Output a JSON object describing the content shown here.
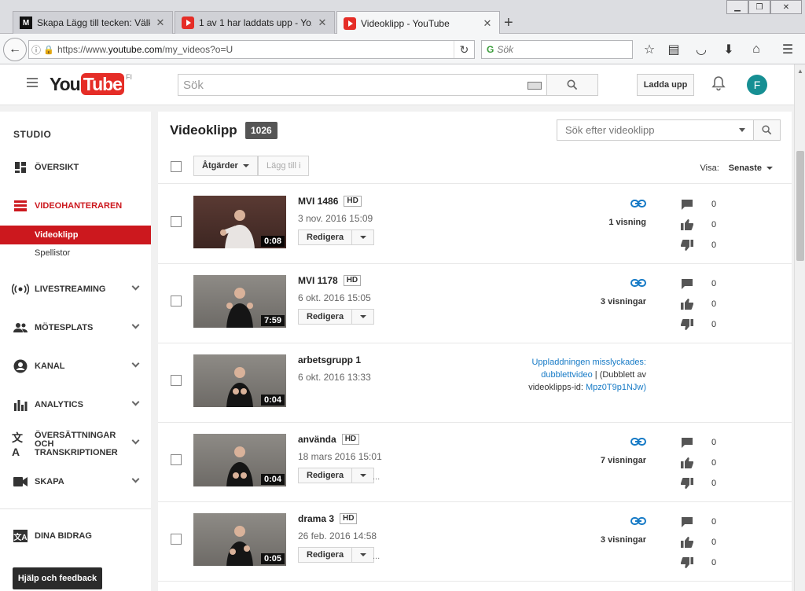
{
  "browser": {
    "tabs": [
      {
        "title": "Skapa Lägg till tecken: Välk...",
        "icon": "mq-favicon"
      },
      {
        "title": "1 av 1 har laddats upp - Yo...",
        "icon": "youtube-favicon"
      },
      {
        "title": "Videoklipp - YouTube",
        "icon": "youtube-favicon"
      }
    ],
    "url_prefix": "https://www.",
    "url_domain": "youtube.com",
    "url_path": "/my_videos?o=U",
    "search_placeholder": "Sök"
  },
  "header": {
    "logo_you": "You",
    "logo_tube": "Tube",
    "logo_country": "FI",
    "search_placeholder": "Sök",
    "upload_label": "Ladda upp",
    "avatar_letter": "F"
  },
  "sidebar": {
    "studio_label": "STUDIO",
    "items": [
      {
        "label": "ÖVERSIKT",
        "icon": "dashboard-icon"
      },
      {
        "label": "VIDEOHANTERAREN",
        "icon": "video-manager-icon"
      },
      {
        "label": "LIVESTREAMING",
        "icon": "live-icon"
      },
      {
        "label": "MÖTESPLATS",
        "icon": "community-icon"
      },
      {
        "label": "KANAL",
        "icon": "channel-icon"
      },
      {
        "label": "ANALYTICS",
        "icon": "analytics-icon"
      },
      {
        "label": "ÖVERSÄTTNINGAR OCH TRANSKRIPTIONER",
        "icon": "translate-icon"
      },
      {
        "label": "SKAPA",
        "icon": "create-icon"
      },
      {
        "label": "DINA BIDRAG",
        "icon": "contributions-icon"
      }
    ],
    "subitems": [
      "Videoklipp",
      "Spellistor"
    ],
    "help_label": "Hjälp och feedback"
  },
  "main": {
    "title": "Videoklipp",
    "count": "1026",
    "video_search_placeholder": "Sök efter videoklipp",
    "actions_label": "Åtgärder",
    "add_to_label": "Lägg till i",
    "view_label": "Visa:",
    "view_value": "Senaste",
    "edit_label": "Redigera",
    "videos": [
      {
        "title": "MVI 1486",
        "hd": "HD",
        "date": "3 nov. 2016 15:09",
        "duration": "0:08",
        "views": "1 visning",
        "comments": "0",
        "likes": "0",
        "dislikes": "0"
      },
      {
        "title": "MVI 1178",
        "hd": "HD",
        "date": "6 okt. 2016 15:05",
        "duration": "7:59",
        "views": "3 visningar",
        "comments": "0",
        "likes": "0",
        "dislikes": "0"
      },
      {
        "title": "arbetsgrupp 1",
        "date": "6 okt. 2016 13:33",
        "duration": "0:04",
        "fail_line1": "Uppladdningen misslyckades:",
        "fail_link": "dubblettvideo",
        "fail_sep": " | ",
        "fail_rest": "(Dubblett av",
        "fail_line3": "videoklipps-id:",
        "fail_id": "Mpz0T9p1NJw)"
      },
      {
        "title": "använda",
        "hd": "HD",
        "date": "18 mars 2016 15:01",
        "duration": "0:04",
        "views": "7 visningar",
        "comments": "0",
        "likes": "0",
        "dislikes": "0",
        "dots": "..."
      },
      {
        "title": "drama 3",
        "hd": "HD",
        "date": "26 feb. 2016 14:58",
        "duration": "0:05",
        "views": "3 visningar",
        "comments": "0",
        "likes": "0",
        "dislikes": "0",
        "dots": "..."
      }
    ]
  }
}
